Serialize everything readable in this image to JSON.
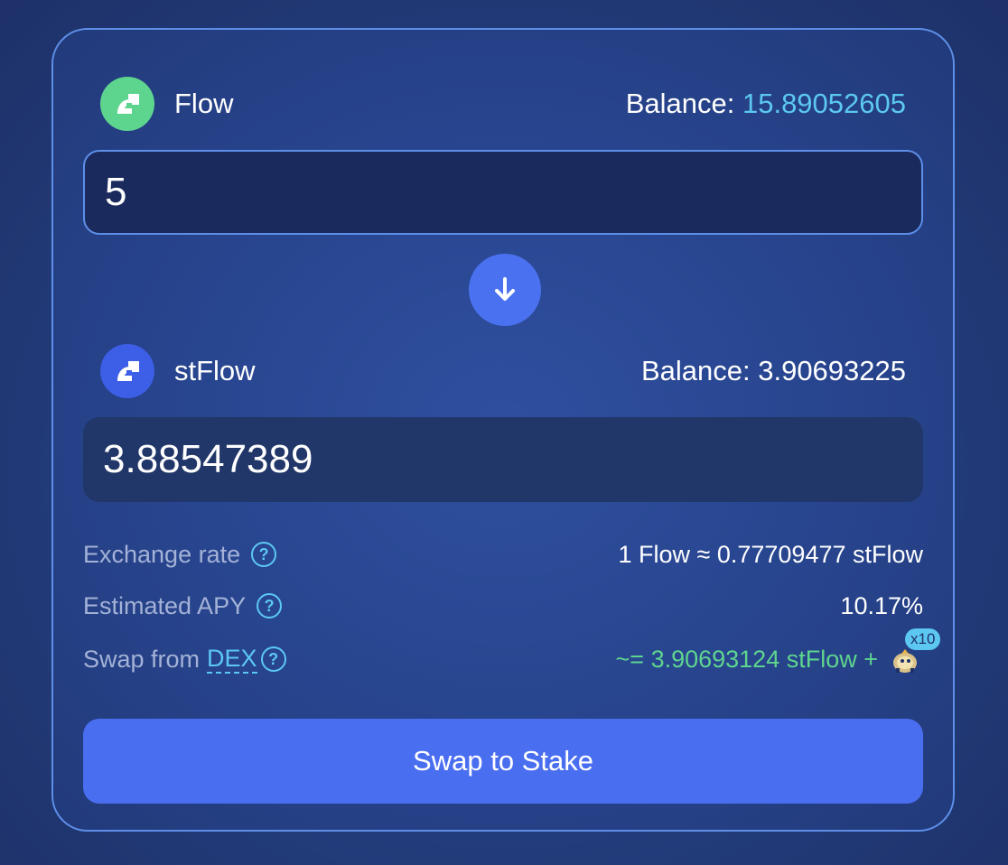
{
  "from": {
    "token_name": "Flow",
    "token_icon": "flow-logo-icon",
    "balance_label": "Balance:",
    "balance_value": "15.89052605",
    "amount": "5"
  },
  "to": {
    "token_name": "stFlow",
    "token_icon": "stflow-logo-icon",
    "balance_label": "Balance:",
    "balance_value": "3.90693225",
    "amount": "3.88547389"
  },
  "info": {
    "exchange_rate_label": "Exchange rate",
    "exchange_rate_value": "1 Flow ≈ 0.77709477 stFlow",
    "apy_label": "Estimated APY",
    "apy_value": "10.17%",
    "swap_from_label": "Swap from",
    "swap_from_link": "DEX",
    "swap_from_value": "~= 3.90693124 stFlow +",
    "bonus_multiplier": "x10"
  },
  "help_glyph": "?",
  "button": {
    "label": "Swap to Stake"
  },
  "colors": {
    "accent": "#4a6ef0",
    "highlight": "#5cc8f2",
    "green": "#5ed58f"
  }
}
